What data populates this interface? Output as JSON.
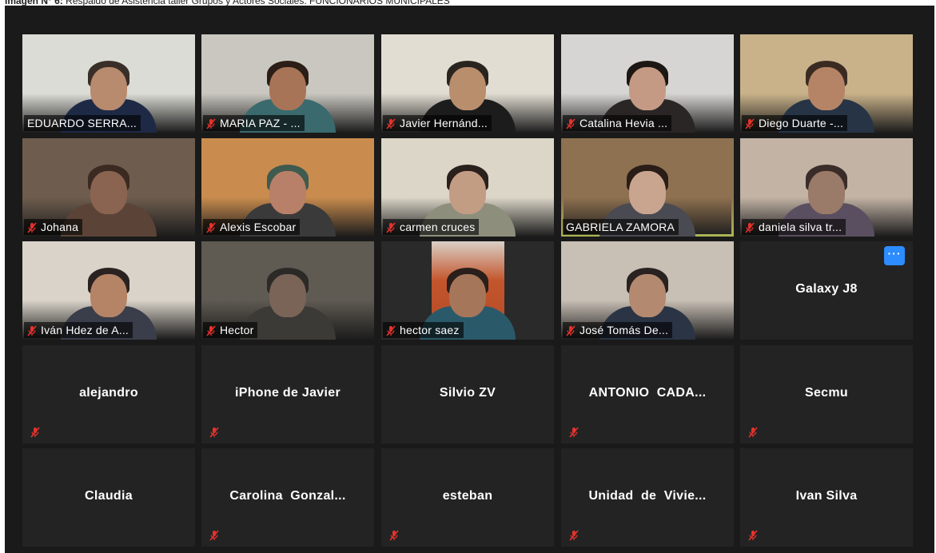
{
  "caption": {
    "label": "Imagen N° 6:",
    "text": "Respaldo de Asistencia taller Grupos y Actores Sociales. FUNCIONARIOS MUNICIPALES"
  },
  "colors": {
    "background": "#1a1a1a",
    "tile": "#232323",
    "speaking_border": "#d7e36a",
    "muted_icon": "#e5322d",
    "more_button": "#2d8cff"
  },
  "participants": [
    {
      "name": "EDUARDO SERRA...",
      "video": true,
      "muted": false,
      "bg": "#dcdcd6",
      "skin": "#b88a6e",
      "hair": "#3a2f28",
      "shirt": "#1e2a45"
    },
    {
      "name": "MARIA PAZ - ...",
      "video": true,
      "muted": true,
      "bg": "#c9c7c0",
      "skin": "#a87458",
      "hair": "#2b1e17",
      "shirt": "#3a6a6e"
    },
    {
      "name": "Javier Hernánd...",
      "video": true,
      "muted": true,
      "bg": "#e2ddd2",
      "skin": "#b98e6d",
      "hair": "#2a2420",
      "shirt": "#1c1c1c"
    },
    {
      "name": "Catalina Hevia ...",
      "video": true,
      "muted": true,
      "bg": "#d7d5d3",
      "skin": "#c49a84",
      "hair": "#1d1714",
      "shirt": "#2a2626"
    },
    {
      "name": "Diego Duarte -...",
      "video": true,
      "muted": true,
      "bg": "#c9b28a",
      "skin": "#b58466",
      "hair": "#3a2b22",
      "shirt": "#263445"
    },
    {
      "name": "Johana",
      "video": true,
      "muted": true,
      "bg": "#6e5d4e",
      "skin": "#8a6450",
      "hair": "#3a2a22",
      "shirt": "#5b4437"
    },
    {
      "name": "Alexis Escobar",
      "video": true,
      "muted": true,
      "bg": "#c98c4e",
      "skin": "#b88068",
      "hair": "#3f5a4e",
      "shirt": "#3b3a3a"
    },
    {
      "name": "carmen cruces",
      "video": true,
      "muted": true,
      "bg": "#dcd6c8",
      "skin": "#c39c84",
      "hair": "#2a201c",
      "shirt": "#8d8f7c"
    },
    {
      "name": "GABRIELA ZAMORA",
      "video": true,
      "muted": false,
      "speaking": true,
      "bg": "#8e7150",
      "skin": "#c9a48f",
      "hair": "#2a1d18",
      "shirt": "#4a4a52"
    },
    {
      "name": "daniela silva tr...",
      "video": true,
      "muted": true,
      "bg": "#c2b3a5",
      "skin": "#9a7a68",
      "hair": "#3a2c28",
      "shirt": "#5a4f60"
    },
    {
      "name": "Iván Hdez de A...",
      "video": true,
      "muted": true,
      "bg": "#d9d3c9",
      "skin": "#b58466",
      "hair": "#2a2220",
      "shirt": "#3a3d4a"
    },
    {
      "name": "Hector",
      "video": true,
      "muted": true,
      "bg": "#5f5a52",
      "skin": "#7a6458",
      "hair": "#2c2a26",
      "shirt": "#3c3a36"
    },
    {
      "name": "hector saez",
      "video": true,
      "muted": true,
      "bg": "#2a2a2a",
      "skin": "#a5765a",
      "hair": "#2a1f1a",
      "shirt": "#2a5a6a",
      "narrow": true
    },
    {
      "name": "José Tomás De...",
      "video": true,
      "muted": true,
      "bg": "#c8bfb5",
      "skin": "#b38a70",
      "hair": "#2a2220",
      "shirt": "#2b3444"
    },
    {
      "name": "Galaxy J8",
      "video": false,
      "muted": false,
      "more": true
    },
    {
      "name": "alejandro",
      "video": false,
      "muted": true
    },
    {
      "name": "iPhone de Javier",
      "video": false,
      "muted": true
    },
    {
      "name": "Silvio ZV",
      "video": false,
      "muted": false
    },
    {
      "name": "ANTONIO  CADA...",
      "video": false,
      "muted": true
    },
    {
      "name": "Secmu",
      "video": false,
      "muted": true
    },
    {
      "name": "Claudia",
      "video": false,
      "muted": false
    },
    {
      "name": "Carolina  Gonzal...",
      "video": false,
      "muted": true
    },
    {
      "name": "esteban",
      "video": false,
      "muted": true
    },
    {
      "name": "Unidad  de  Vivie...",
      "video": false,
      "muted": true
    },
    {
      "name": "Ivan Silva",
      "video": false,
      "muted": true
    }
  ],
  "more_button_label": "···"
}
